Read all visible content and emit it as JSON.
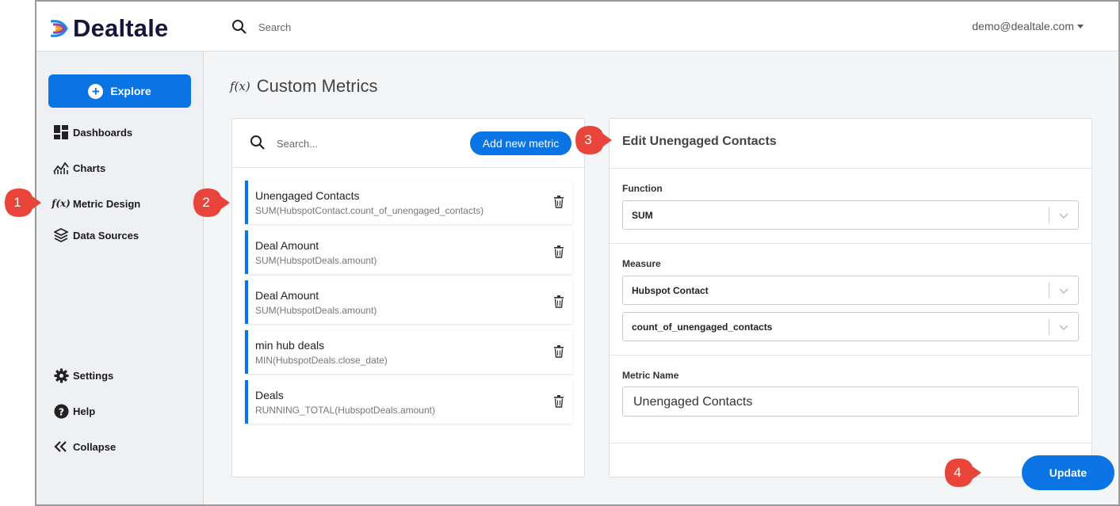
{
  "app": {
    "logo_text": "Dealtale"
  },
  "topbar": {
    "search_placeholder": "Search",
    "user_email": "demo@dealtale.com"
  },
  "sidebar": {
    "explore_label": "Explore",
    "items": [
      {
        "label": "Dashboards",
        "icon": "dashboard-icon"
      },
      {
        "label": "Charts",
        "icon": "chart-icon"
      },
      {
        "label": "Metric Design",
        "icon": "function-icon"
      },
      {
        "label": "Data Sources",
        "icon": "layers-icon"
      },
      {
        "label": "Settings",
        "icon": "gear-icon"
      },
      {
        "label": "Help",
        "icon": "help-icon"
      },
      {
        "label": "Collapse",
        "icon": "collapse-icon"
      }
    ]
  },
  "page": {
    "title": "Custom Metrics",
    "title_icon_text": "f(x)"
  },
  "metrics_list": {
    "search_placeholder": "Search...",
    "add_button_label": "Add new metric",
    "items": [
      {
        "name": "Unengaged Contacts",
        "formula": "SUM(HubspotContact.count_of_unengaged_contacts)"
      },
      {
        "name": "Deal Amount",
        "formula": "SUM(HubspotDeals.amount)"
      },
      {
        "name": "Deal Amount",
        "formula": "SUM(HubspotDeals.amount)"
      },
      {
        "name": "min hub deals",
        "formula": "MIN(HubspotDeals.close_date)"
      },
      {
        "name": "Deals",
        "formula": "RUNNING_TOTAL(HubspotDeals.amount)"
      }
    ]
  },
  "edit_panel": {
    "title": "Edit Unengaged Contacts",
    "function_label": "Function",
    "function_value": "SUM",
    "measure_label": "Measure",
    "measure_source_value": "Hubspot Contact",
    "measure_field_value": "count_of_unengaged_contacts",
    "metric_name_label": "Metric Name",
    "metric_name_value": "Unengaged Contacts",
    "update_button_label": "Update"
  },
  "callouts": [
    "1",
    "2",
    "3",
    "4"
  ],
  "colors": {
    "accent": "#0b74e5",
    "callout_red": "#e8443a",
    "logo_dark": "#15163a"
  }
}
